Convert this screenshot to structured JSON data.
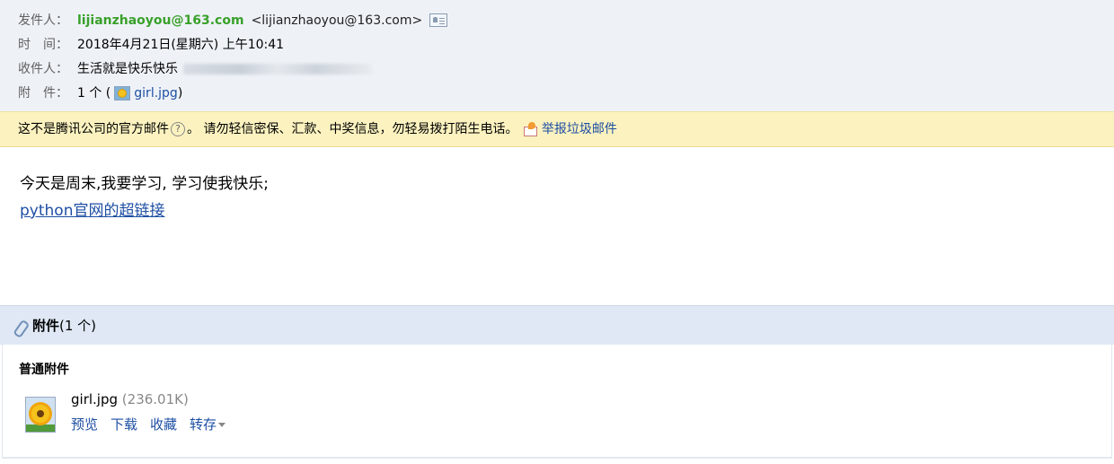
{
  "header": {
    "from_label": "发件人：",
    "from_name": "lijianzhaoyou@163.com",
    "from_addr": "<lijianzhaoyou@163.com>",
    "time_label": "时　间：",
    "time_value": "2018年4月21日(星期六) 上午10:41",
    "to_label": "收件人：",
    "to_value": "生活就是快乐快乐",
    "att_label": "附　件：",
    "att_prefix": "1 个 (",
    "att_name": "girl.jpg",
    "att_suffix": ")"
  },
  "warning": {
    "text1": "这不是腾讯公司的官方邮件",
    "qmark": "?",
    "text2": "。 请勿轻信密保、汇款、中奖信息，勿轻易拨打陌生电话。",
    "report_link": "举报垃圾邮件"
  },
  "body": {
    "line1": "今天是周末,我要学习, 学习使我快乐;",
    "line2": "python官网的超链接"
  },
  "attachments": {
    "bar_title": "附件",
    "bar_count": "(1 个)",
    "section": "普通附件",
    "file_name": "girl.jpg",
    "file_size": "(236.01K)",
    "actions": [
      "预览",
      "下载",
      "收藏",
      "转存"
    ]
  },
  "icons": {
    "card": "contact-card-icon",
    "thumb": "image-thumbnail-icon",
    "help": "help-icon",
    "spam": "report-spam-icon",
    "clip": "paperclip-icon",
    "file": "image-file-icon",
    "caret": "chevron-down-icon"
  },
  "colors": {
    "sender": "#39a02a",
    "link": "#1e4fa3",
    "header_bg": "#eef2f7",
    "warning_bg": "#fbf2bf",
    "attach_bar_bg": "#dfe8f4"
  }
}
